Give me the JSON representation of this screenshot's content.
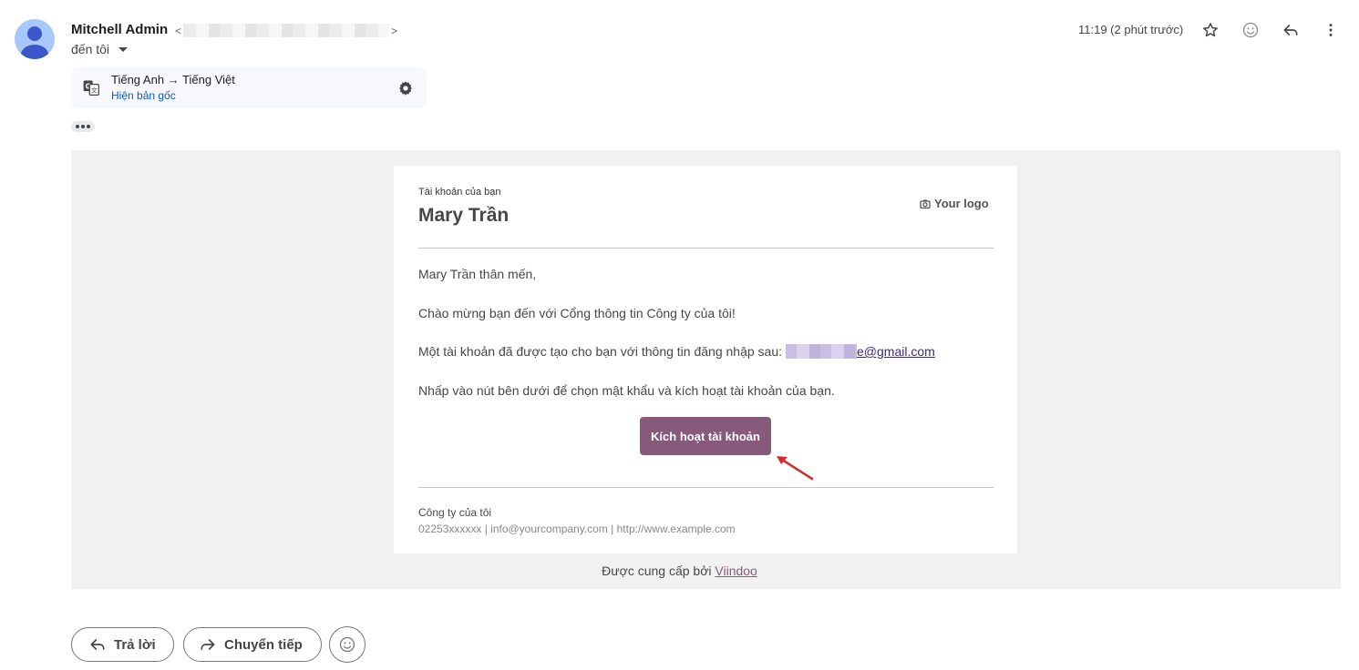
{
  "header": {
    "sender_name": "Mitchell Admin",
    "email_open": "<",
    "email_close": ">",
    "to_label": "đến tôi",
    "time": "11:19 (2 phút trước)",
    "icons": [
      "star-icon",
      "emoji-icon",
      "reply-icon",
      "more-vert-icon"
    ]
  },
  "translate_bar": {
    "languages": "Tiếng Anh → Tiếng Việt",
    "show_original": "Hiện bản gốc"
  },
  "email": {
    "account_label": "Tài khoản của bạn",
    "recipient_name": "Mary Trần",
    "logo_text": "Your logo",
    "greeting": "Mary Trần thân mến,",
    "welcome": "Chào mừng bạn đến với Cổng thông tin Công ty của tôi!",
    "account_created": "Một tài khoản đã được tạo cho bạn với thông tin đăng nhập sau:",
    "login_email_visible": "e@gmail.com",
    "instructions": "Nhấp vào nút bên dưới để chọn mật khẩu và kích hoạt tài khoản của bạn.",
    "activate_button": "Kích hoạt tài khoản",
    "company_name": "Công ty của tôi",
    "company_contact": "02253xxxxxx | info@yourcompany.com | http://www.example.com",
    "powered_by_prefix": "Được cung cấp bởi ",
    "powered_by_link": "Viindoo"
  },
  "actions": {
    "reply": "Trả lời",
    "forward": "Chuyển tiếp"
  },
  "colors": {
    "accent_button": "#875a7b",
    "link_blue": "#0b57d0",
    "annotation_arrow": "#d32f2f"
  }
}
